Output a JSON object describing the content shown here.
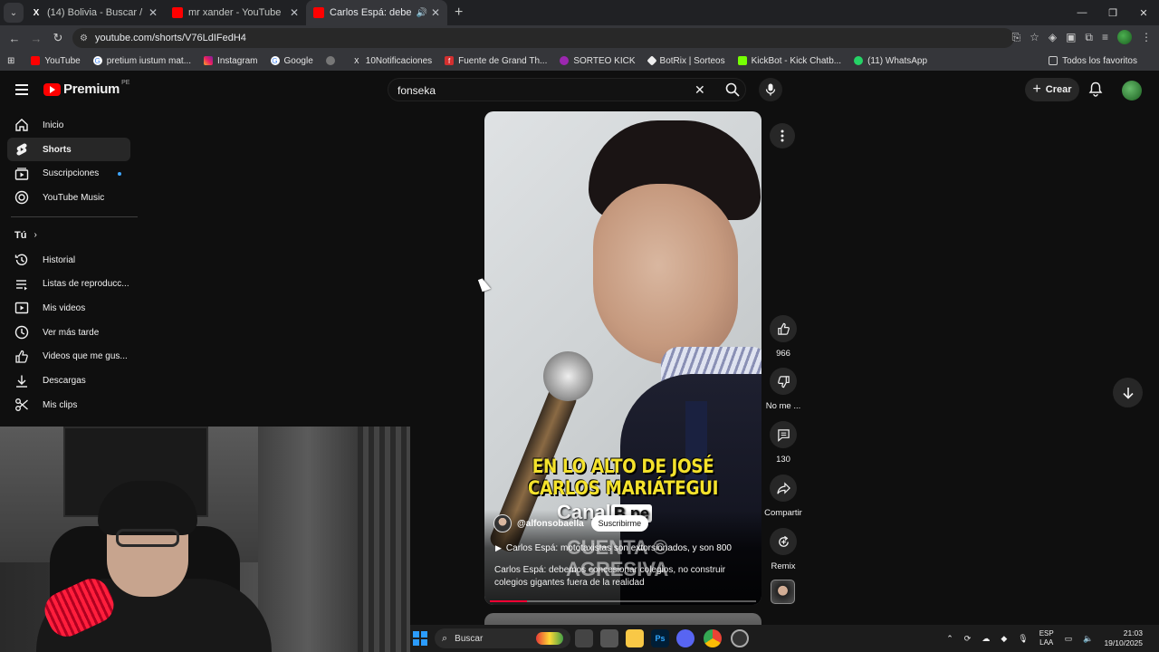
{
  "browser": {
    "tabs": [
      {
        "title": "(14) Bolivia - Buscar / X",
        "favicon": "x-icon"
      },
      {
        "title": "mr xander - YouTube",
        "favicon": "youtube-icon"
      },
      {
        "title": "Carlos Espá: debemos conc",
        "favicon": "youtube-icon",
        "active": true
      }
    ],
    "url": "youtube.com/shorts/V76LdIFedH4",
    "bookmarks": [
      "YouTube",
      "pretium iustum mat...",
      "Instagram",
      "Google",
      "",
      "10Notificaciones",
      "Fuente de Grand Th...",
      "SORTEO KICK",
      "BotRix | Sorteos",
      "KickBot - Kick Chatb...",
      "(11) WhatsApp"
    ],
    "all_bookmarks": "Todos los favoritos"
  },
  "header": {
    "logo": "Premium",
    "country": "PE",
    "search_value": "fonseka",
    "create_label": "Crear"
  },
  "sidebar": {
    "main": [
      {
        "label": "Inicio",
        "icon": "home-icon"
      },
      {
        "label": "Shorts",
        "icon": "shorts-icon",
        "active": true
      },
      {
        "label": "Suscripciones",
        "icon": "subscriptions-icon",
        "dot": true
      },
      {
        "label": "YouTube Music",
        "icon": "music-icon"
      }
    ],
    "you_label": "Tú",
    "you": [
      {
        "label": "Historial",
        "icon": "history-icon"
      },
      {
        "label": "Listas de reproducc...",
        "icon": "playlist-icon"
      },
      {
        "label": "Mis videos",
        "icon": "my-videos-icon"
      },
      {
        "label": "Ver más tarde",
        "icon": "clock-icon"
      },
      {
        "label": "Videos que me gus...",
        "icon": "like-icon"
      },
      {
        "label": "Descargas",
        "icon": "download-icon"
      },
      {
        "label": "Mis clips",
        "icon": "scissors-icon"
      }
    ]
  },
  "short": {
    "caption_line1": "EN LO ALTO DE JOSÉ",
    "caption_line2": "CARLOS MARIÁTEGUI",
    "watermark_brand": "Canal",
    "watermark_brand2": "B.pe",
    "watermark2_line1": "CUENTA ©",
    "watermark2_line2": "AGRESIVA",
    "channel": "@alfonsobaella",
    "subscribe_label": "Suscribirme",
    "related": "Carlos Espá: mototaxistas son extorsionados, y son 800",
    "title": "Carlos Espá: debemos concesionar colegios, no construir colegios gigantes fuera de la realidad",
    "progress": 0.14
  },
  "actions": {
    "likes": "966",
    "dislike_label": "No me ...",
    "comments": "130",
    "share_label": "Compartir",
    "remix_label": "Remix"
  },
  "taskbar": {
    "search_placeholder": "Buscar",
    "lang1": "ESP",
    "lang2": "LAA",
    "time": "21:03",
    "date": "19/10/2025"
  }
}
